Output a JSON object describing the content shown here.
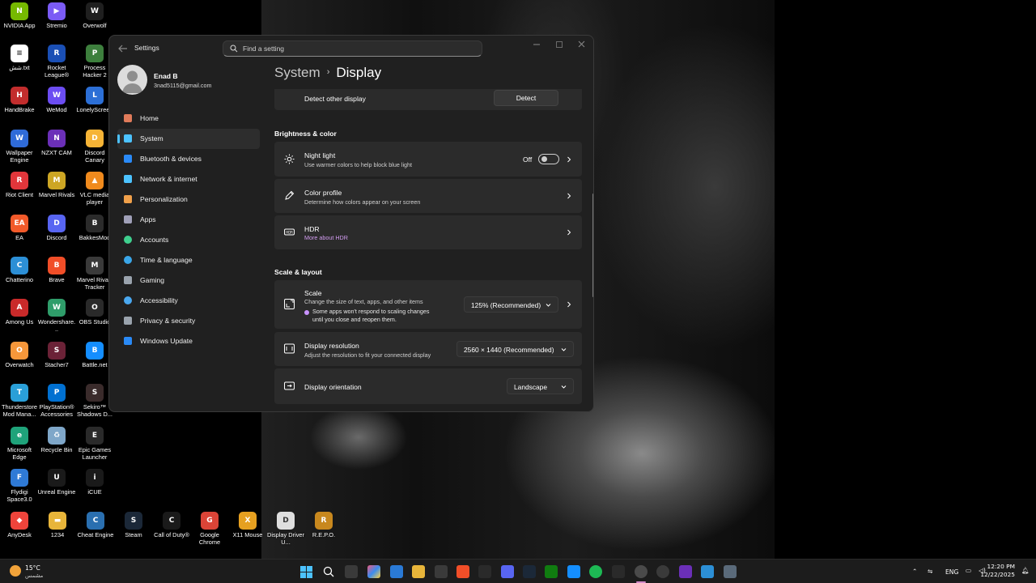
{
  "desktop": {
    "icons": [
      {
        "label": "NVIDIA App",
        "color": "#76b900",
        "glyph": "N"
      },
      {
        "label": "Stremio",
        "color": "#7b5bf5",
        "glyph": "▶"
      },
      {
        "label": "Overwolf",
        "color": "#1f1f1f",
        "glyph": "W"
      },
      {
        "label": "شش.txt",
        "color": "#ffffff",
        "glyph": "≡"
      },
      {
        "label": "Rocket League®",
        "color": "#1a4fb5",
        "glyph": "R"
      },
      {
        "label": "Process Hacker 2",
        "color": "#3d7f3d",
        "glyph": "P"
      },
      {
        "label": "HandBrake",
        "color": "#c22d2d",
        "glyph": "H"
      },
      {
        "label": "WeMod",
        "color": "#6c4df2",
        "glyph": "W"
      },
      {
        "label": "LonelyScreen",
        "color": "#2c6fd6",
        "glyph": "L"
      },
      {
        "label": "Wallpaper Engine",
        "color": "#2f6bd8",
        "glyph": "W"
      },
      {
        "label": "NZXT CAM",
        "color": "#6b2fb8",
        "glyph": "N"
      },
      {
        "label": "Discord Canary",
        "color": "#f6b436",
        "glyph": "D"
      },
      {
        "label": "Riot Client",
        "color": "#e2363b",
        "glyph": "R"
      },
      {
        "label": "Marvel Rivals",
        "color": "#cda624",
        "glyph": "M"
      },
      {
        "label": "VLC media player",
        "color": "#f08a1d",
        "glyph": "▲"
      },
      {
        "label": "EA",
        "color": "#f25a2a",
        "glyph": "EA"
      },
      {
        "label": "Discord",
        "color": "#5865f2",
        "glyph": "D"
      },
      {
        "label": "BakkesMod",
        "color": "#2b2b2b",
        "glyph": "B"
      },
      {
        "label": "Chatterino",
        "color": "#2c8fd6",
        "glyph": "C"
      },
      {
        "label": "Brave",
        "color": "#f14e28",
        "glyph": "B"
      },
      {
        "label": "Marvel Rivals Tracker",
        "color": "#3a3a3a",
        "glyph": "M"
      },
      {
        "label": "Among Us",
        "color": "#c92a2a",
        "glyph": "A"
      },
      {
        "label": "Wondershare...",
        "color": "#2f9d6a",
        "glyph": "W"
      },
      {
        "label": "OBS Studio",
        "color": "#2a2a2a",
        "glyph": "O"
      },
      {
        "label": "Overwatch",
        "color": "#f6973a",
        "glyph": "O"
      },
      {
        "label": "Stacher7",
        "color": "#6b2237",
        "glyph": "S"
      },
      {
        "label": "Battle.net",
        "color": "#148eff",
        "glyph": "B"
      },
      {
        "label": "Thunderstore Mod Mana...",
        "color": "#2a9fd8",
        "glyph": "T"
      },
      {
        "label": "PlayStation® Accessories",
        "color": "#0070d1",
        "glyph": "P"
      },
      {
        "label": "Sekiro™ Shadows D...",
        "color": "#3a2b2b",
        "glyph": "S"
      },
      {
        "label": "Microsoft Edge",
        "color": "#1fa37a",
        "glyph": "e"
      },
      {
        "label": "Recycle Bin",
        "color": "#7fa7c9",
        "glyph": "♻"
      },
      {
        "label": "Epic Games Launcher",
        "color": "#2a2a2a",
        "glyph": "E"
      },
      {
        "label": "Flydigi Space3.0",
        "color": "#2f7ad6",
        "glyph": "F"
      },
      {
        "label": "Unreal Engine",
        "color": "#1a1a1a",
        "glyph": "U"
      },
      {
        "label": "iCUE",
        "color": "#1a1a1a",
        "glyph": "i"
      },
      {
        "label": "AnyDesk",
        "color": "#ef443b",
        "glyph": "◆"
      },
      {
        "label": "1234",
        "color": "#e8b53a",
        "glyph": "▬"
      },
      {
        "label": "Cheat Engine",
        "color": "#2a6fb0",
        "glyph": "C"
      },
      {
        "label": "Steam",
        "color": "#1b2838",
        "glyph": "S"
      },
      {
        "label": "Call of Duty®",
        "color": "#1a1a1a",
        "glyph": "C"
      },
      {
        "label": "Google Chrome",
        "color": "#db4437",
        "glyph": "G"
      },
      {
        "label": "X11 Mouse",
        "color": "#e6a020",
        "glyph": "X"
      },
      {
        "label": "Display Driver U...",
        "color": "#dedede",
        "glyph": "D"
      },
      {
        "label": "R.E.P.O.",
        "color": "#c8881e",
        "glyph": "R"
      }
    ]
  },
  "window": {
    "app_title": "Settings",
    "search_placeholder": "Find a setting",
    "user": {
      "name": "Enad B",
      "email": "3nad5115@gmail.com"
    },
    "nav": [
      {
        "label": "Home",
        "icon": "home-icon",
        "color": "#e07b5a"
      },
      {
        "label": "System",
        "icon": "system-icon",
        "color": "#4cc2ff"
      },
      {
        "label": "Bluetooth & devices",
        "icon": "bluetooth-icon",
        "color": "#2a8af6"
      },
      {
        "label": "Network & internet",
        "icon": "network-icon",
        "color": "#4cc2ff"
      },
      {
        "label": "Personalization",
        "icon": "personalization-icon",
        "color": "#f0a04a"
      },
      {
        "label": "Apps",
        "icon": "apps-icon",
        "color": "#a0a0b8"
      },
      {
        "label": "Accounts",
        "icon": "accounts-icon",
        "color": "#3fcf8e"
      },
      {
        "label": "Time & language",
        "icon": "time-language-icon",
        "color": "#3aa6e8"
      },
      {
        "label": "Gaming",
        "icon": "gaming-icon",
        "color": "#9aa3ad"
      },
      {
        "label": "Accessibility",
        "icon": "accessibility-icon",
        "color": "#4aa8f0"
      },
      {
        "label": "Privacy & security",
        "icon": "shield-icon",
        "color": "#9aa3ad"
      },
      {
        "label": "Windows Update",
        "icon": "windows-update-icon",
        "color": "#2a8af6"
      }
    ],
    "breadcrumb": {
      "parent": "System",
      "current": "Display"
    },
    "detect": {
      "label": "Detect other display",
      "button": "Detect"
    },
    "brightness_section": "Brightness & color",
    "night_light": {
      "title": "Night light",
      "subtitle": "Use warmer colors to help block blue light",
      "state": "Off"
    },
    "color_profile": {
      "title": "Color profile",
      "subtitle": "Determine how colors appear on your screen"
    },
    "hdr": {
      "title": "HDR",
      "link": "More about HDR"
    },
    "scale_section": "Scale & layout",
    "scale": {
      "title": "Scale",
      "subtitle": "Change the size of text, apps, and other items",
      "note_line1": "Some apps won't respond to scaling changes",
      "note_line2": "until you close and reopen them.",
      "value": "125% (Recommended)"
    },
    "resolution": {
      "title": "Display resolution",
      "subtitle": "Adjust the resolution to fit your connected display",
      "value": "2560 × 1440 (Recommended)"
    },
    "orientation": {
      "title": "Display orientation",
      "value": "Landscape"
    }
  },
  "taskbar": {
    "weather": {
      "temp": "15°C",
      "condition": "مشمس"
    },
    "language": "ENG",
    "time": "12:20 PM",
    "date": "12/22/2025"
  },
  "colors": {
    "accent": "#4cc2ff",
    "link": "#d29cf0"
  }
}
